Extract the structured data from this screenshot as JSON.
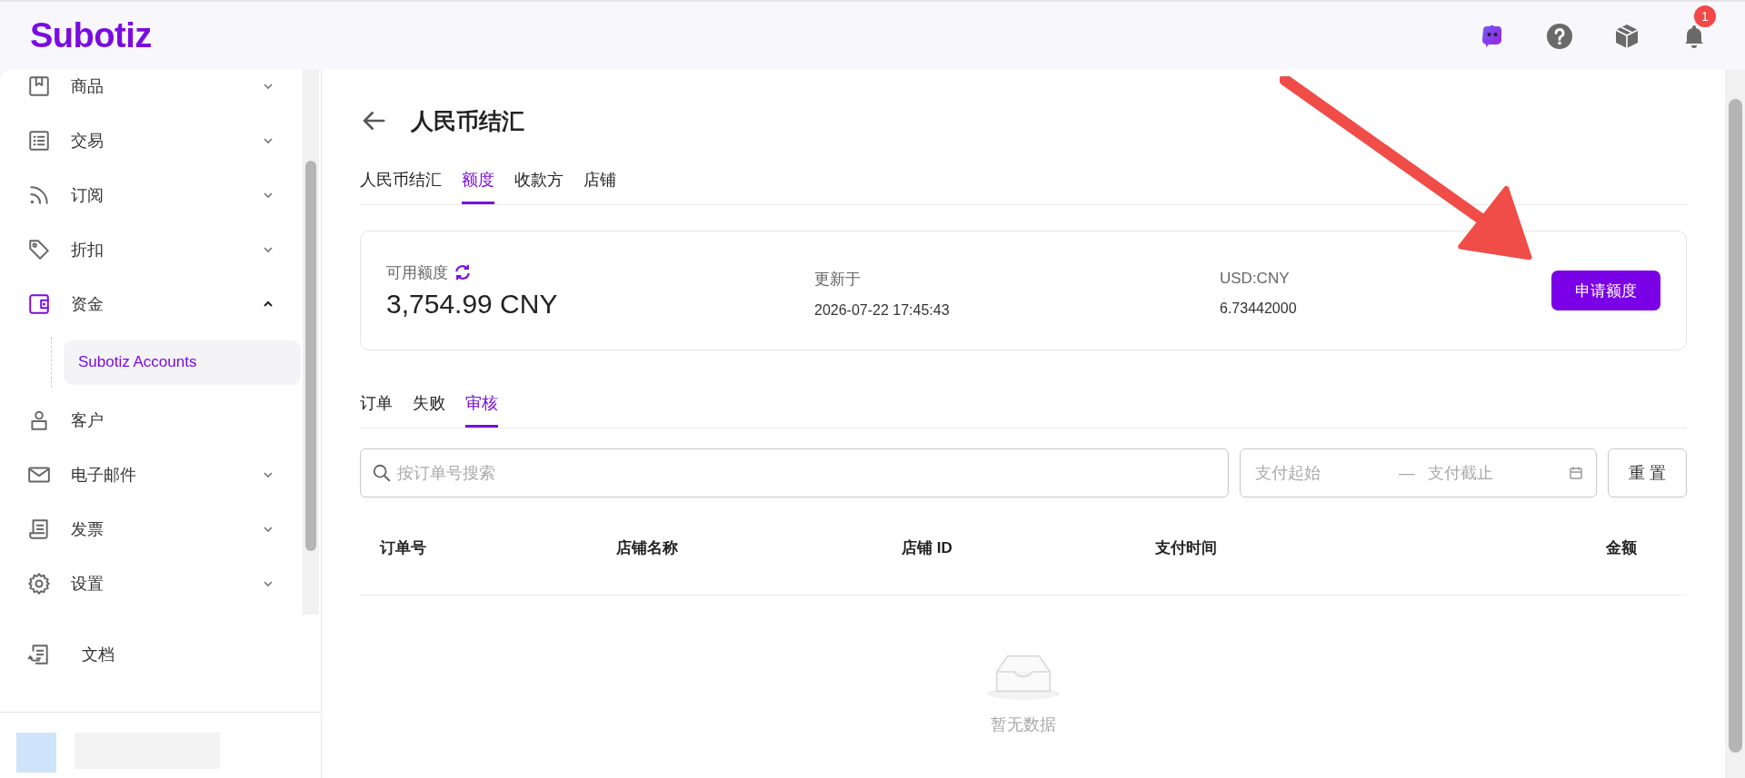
{
  "header": {
    "logo": "Subotiz",
    "notifications": {
      "count": "1"
    }
  },
  "sidebar": {
    "items": [
      {
        "label": "商品",
        "expanded": false,
        "active": false
      },
      {
        "label": "交易",
        "expanded": false,
        "active": false
      },
      {
        "label": "订阅",
        "expanded": false,
        "active": false
      },
      {
        "label": "折扣",
        "expanded": false,
        "active": false
      },
      {
        "label": "资金",
        "expanded": true,
        "active": true,
        "children": [
          {
            "label": "Subotiz Accounts",
            "selected": true
          }
        ]
      },
      {
        "label": "客户",
        "active": false
      },
      {
        "label": "电子邮件",
        "expanded": false,
        "active": false
      },
      {
        "label": "发票",
        "expanded": false,
        "active": false
      },
      {
        "label": "设置",
        "expanded": false,
        "active": false
      }
    ],
    "footer_item": {
      "label": "文档"
    }
  },
  "page": {
    "title": "人民币结汇",
    "tabs": [
      {
        "label": "人民币结汇",
        "selected": false
      },
      {
        "label": "额度",
        "selected": true
      },
      {
        "label": "收款方",
        "selected": false
      },
      {
        "label": "店铺",
        "selected": false
      }
    ],
    "quota_card": {
      "available": {
        "label": "可用额度",
        "value": "3,754.99 CNY"
      },
      "updated": {
        "label": "更新于",
        "value": "2026-07-22 17:45:43"
      },
      "rate": {
        "label": "USD:CNY",
        "value": "6.73442000"
      },
      "button": "申请额度"
    },
    "sub_tabs": [
      {
        "label": "订单",
        "selected": false
      },
      {
        "label": "失败",
        "selected": false
      },
      {
        "label": "审核",
        "selected": true
      }
    ],
    "filters": {
      "search": {
        "placeholder": "按订单号搜索"
      },
      "date_start": {
        "placeholder": "支付起始"
      },
      "separator": "—",
      "date_end": {
        "placeholder": "支付截止"
      },
      "reset": "重 置"
    },
    "table": {
      "columns": [
        "订单号",
        "店铺名称",
        "店铺 ID",
        "支付时间",
        "金额"
      ],
      "empty_text": "暂无数据"
    }
  }
}
